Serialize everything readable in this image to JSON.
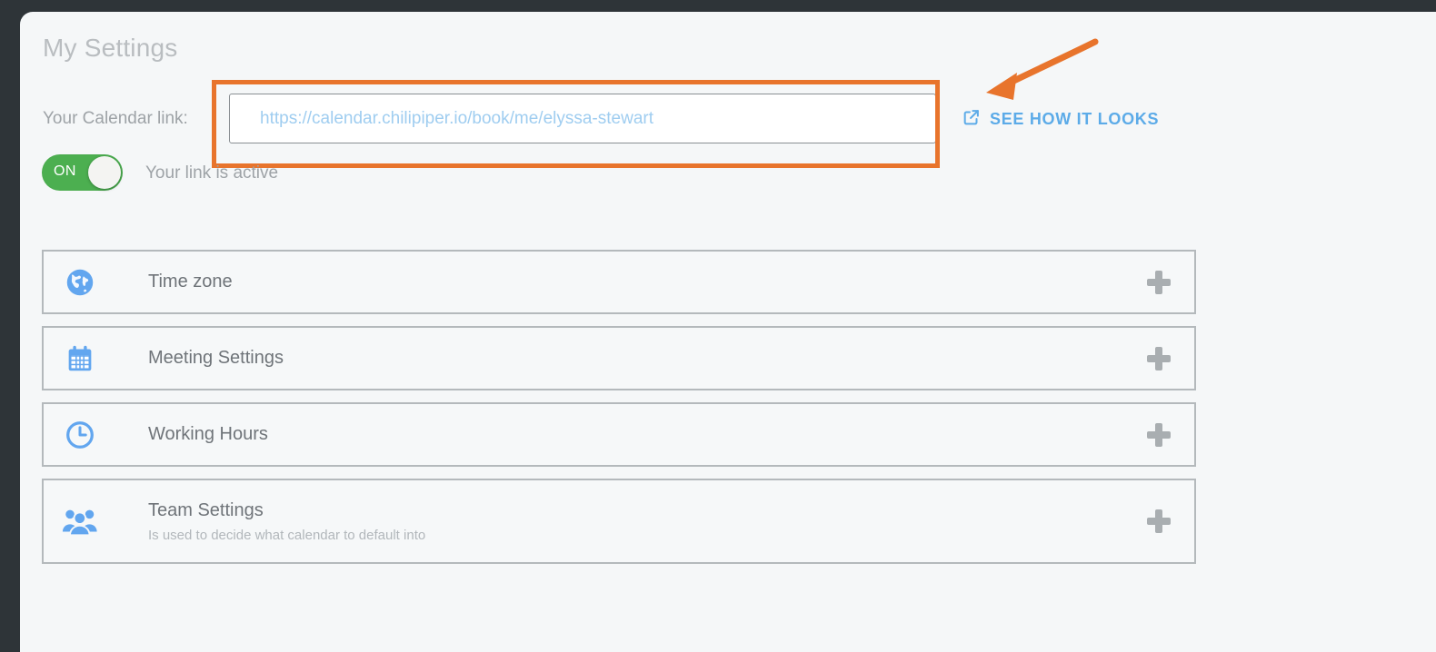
{
  "window": {
    "chrome_color": "#2e3438",
    "panel_background": "#f5f7f8"
  },
  "header": {
    "title": "My Settings"
  },
  "calendar_link": {
    "label": "Your Calendar link:",
    "value": "https://calendar.chilipiper.io/book/me/elyssa-stewart",
    "placeholder": "https://calendar.chilipiper.io/book/me/elyssa-stewart",
    "see_how_it_looks": "SEE HOW IT LOOKS",
    "see_icon": "external-link-icon",
    "link_color": "#5cabe8",
    "input_text_color": "#9fcdf0"
  },
  "annotation": {
    "highlight_color": "#e8742c",
    "arrow": "curved-arrow-pointing-to-calendar-link-input"
  },
  "link_toggle": {
    "state_label": "ON",
    "caption": "Your link is active",
    "on_color": "#4caf50",
    "is_on": true
  },
  "settings_cards": [
    {
      "icon": "globe-icon",
      "title": "Time zone",
      "subtitle": "",
      "expand": "plus-icon"
    },
    {
      "icon": "calendar-icon",
      "title": "Meeting Settings",
      "subtitle": "",
      "expand": "plus-icon"
    },
    {
      "icon": "clock-icon",
      "title": "Working Hours",
      "subtitle": "",
      "expand": "plus-icon"
    },
    {
      "icon": "people-icon",
      "title": "Team Settings",
      "subtitle": "Is used to decide what calendar to default into",
      "expand": "plus-icon"
    }
  ],
  "icon_color": "#62a6ef"
}
